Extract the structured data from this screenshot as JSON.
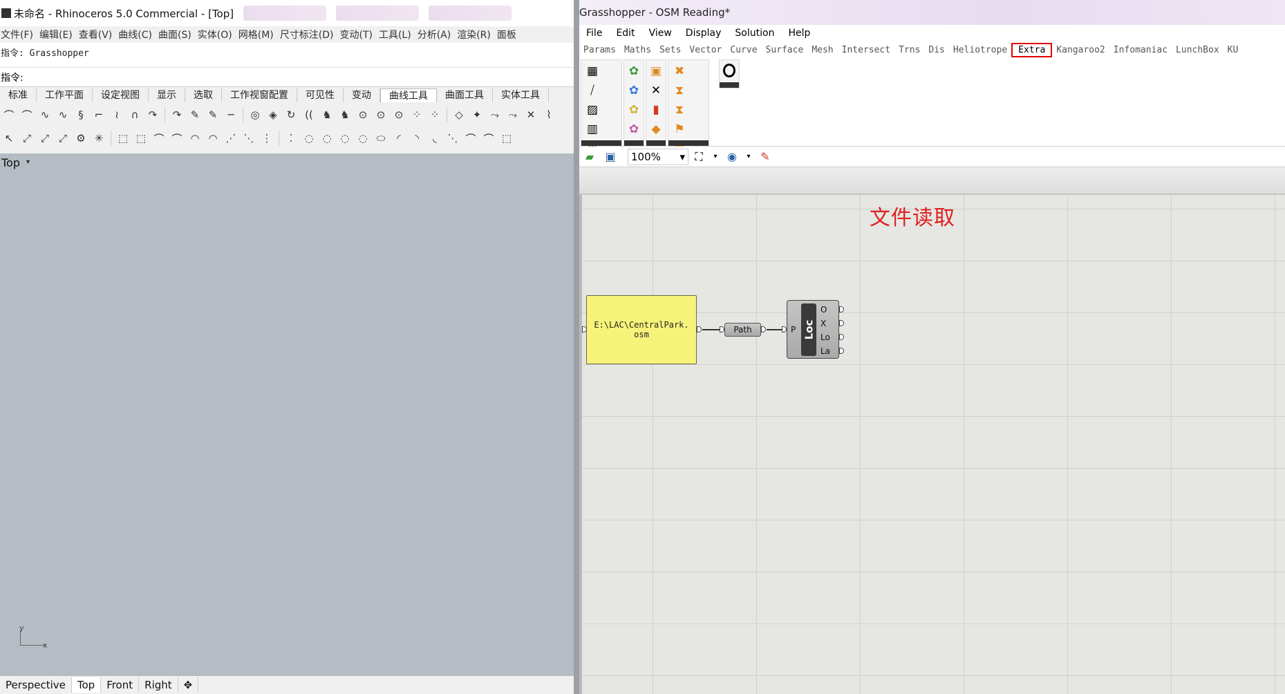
{
  "rhino": {
    "title": "未命名 - Rhinoceros 5.0 Commercial - [Top]",
    "menu": [
      "文件(F)",
      "编辑(E)",
      "查看(V)",
      "曲线(C)",
      "曲面(S)",
      "实体(O)",
      "网格(M)",
      "尺寸标注(D)",
      "变动(T)",
      "工具(L)",
      "分析(A)",
      "渲染(R)",
      "面板"
    ],
    "command_history": "指令: Grasshopper",
    "command_prompt": "指令:",
    "toolbar_tabs": [
      "标准",
      "工作平面",
      "设定视图",
      "显示",
      "选取",
      "工作视窗配置",
      "可见性",
      "变动",
      "曲线工具",
      "曲面工具",
      "实体工具"
    ],
    "active_toolbar_tab": "曲线工具",
    "viewport_label": "Top",
    "axis": {
      "x": "x",
      "y": "y"
    },
    "viewport_tabs": [
      "Perspective",
      "Top",
      "Front",
      "Right"
    ],
    "viewport_add_icon": "add-viewport-icon"
  },
  "grasshopper": {
    "title": "Grasshopper - OSM Reading*",
    "menu": [
      "File",
      "Edit",
      "View",
      "Display",
      "Solution",
      "Help"
    ],
    "component_tabs": [
      "Params",
      "Maths",
      "Sets",
      "Vector",
      "Curve",
      "Surface",
      "Mesh",
      "Intersect",
      "Trns",
      "Dis",
      "Heliotrope",
      "Extra",
      "Kangaroo2",
      "Infomaniac",
      "LunchBox",
      "KU"
    ],
    "active_component_tab": "Extra",
    "highlight_color": "#e00000",
    "zoom": "100%",
    "annotation": "文件读取",
    "annotation_color": "#e02020",
    "panel_text": "E:\\LAC\\CentralPark.osm",
    "panel_color": "#f7f37a",
    "relay_label": "Path",
    "component": {
      "name": "Loc",
      "input": "P",
      "outputs": [
        "O",
        "X",
        "Lo",
        "La"
      ]
    }
  }
}
